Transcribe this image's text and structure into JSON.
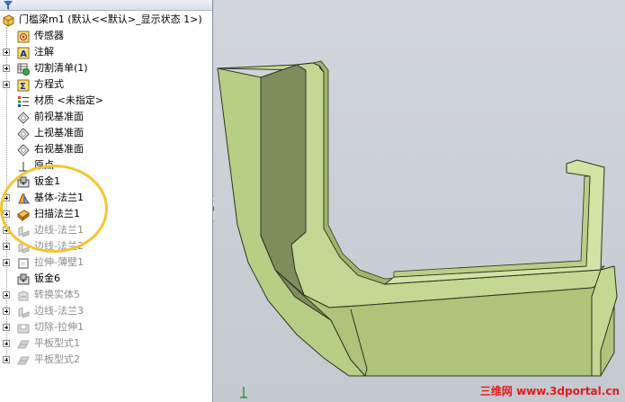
{
  "tree": {
    "root": "门槛梁m1 (默认<<默认>_显示状态 1>)",
    "items": [
      {
        "label": "传感器",
        "icon": "sensor-icon",
        "grey": false,
        "expander": false
      },
      {
        "label": "注解",
        "icon": "annotation-icon",
        "grey": false,
        "expander": true
      },
      {
        "label": "切割清单(1)",
        "icon": "cut-list-icon",
        "grey": false,
        "expander": true
      },
      {
        "label": "方程式",
        "icon": "equation-icon",
        "grey": false,
        "expander": true
      },
      {
        "label": "材质 <未指定>",
        "icon": "material-icon",
        "grey": false,
        "expander": false
      },
      {
        "label": "前视基准面",
        "icon": "plane-icon",
        "grey": false,
        "expander": false
      },
      {
        "label": "上视基准面",
        "icon": "plane-icon",
        "grey": false,
        "expander": false
      },
      {
        "label": "右视基准面",
        "icon": "plane-icon",
        "grey": false,
        "expander": false
      },
      {
        "label": "原点",
        "icon": "origin-icon",
        "grey": false,
        "expander": false
      },
      {
        "label": "钣金1",
        "icon": "sheet-metal-icon",
        "grey": false,
        "expander": false
      },
      {
        "label": "基体-法兰1",
        "icon": "base-flange-icon",
        "grey": false,
        "expander": true
      },
      {
        "label": "扫描法兰1",
        "icon": "swept-flange-icon",
        "grey": false,
        "expander": true
      },
      {
        "label": "边线-法兰1",
        "icon": "edge-flange-icon",
        "grey": true,
        "expander": true
      },
      {
        "label": "边线-法兰2",
        "icon": "edge-flange-icon",
        "grey": true,
        "expander": true
      },
      {
        "label": "拉伸-薄壁1",
        "icon": "extrude-thin-icon",
        "grey": true,
        "expander": true
      },
      {
        "label": "钣金6",
        "icon": "sheet-metal-icon",
        "grey": false,
        "expander": false
      },
      {
        "label": "转换实体5",
        "icon": "convert-entities-icon",
        "grey": true,
        "expander": true
      },
      {
        "label": "边线-法兰3",
        "icon": "edge-flange-icon",
        "grey": true,
        "expander": true
      },
      {
        "label": "切除-拉伸1",
        "icon": "cut-extrude-icon",
        "grey": true,
        "expander": true
      },
      {
        "label": "平板型式1",
        "icon": "flat-pattern-icon",
        "grey": true,
        "expander": true
      },
      {
        "label": "平板型式2",
        "icon": "flat-pattern-icon",
        "grey": true,
        "expander": true
      }
    ]
  },
  "watermark": "三维网 www.3dportal.cn",
  "colors": {
    "model_face": "#b7cf84",
    "model_dark": "#7f8c5c",
    "highlight": "#f4c531"
  }
}
